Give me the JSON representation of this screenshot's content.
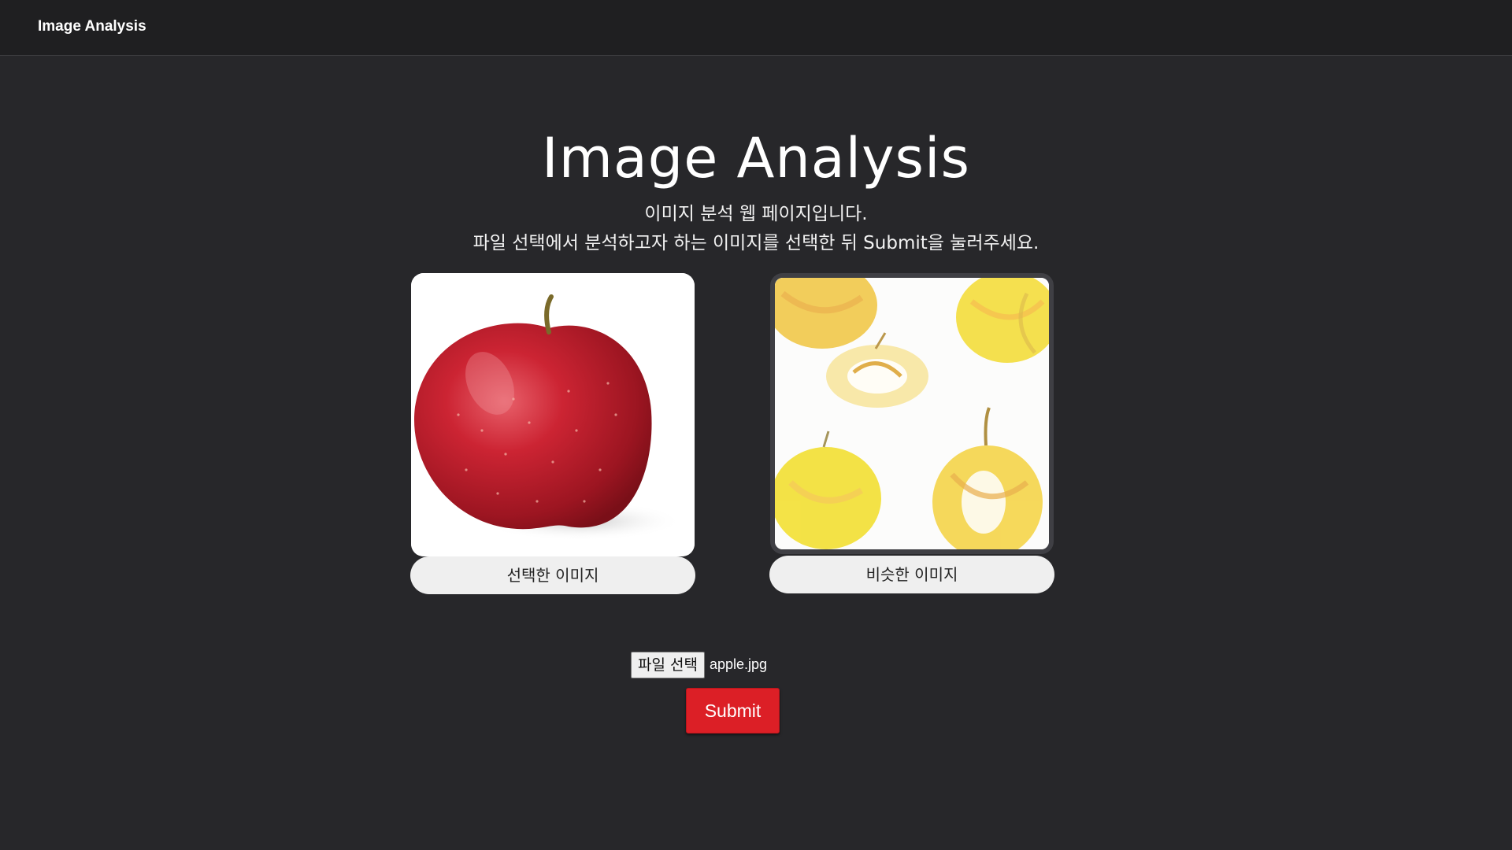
{
  "navbar": {
    "brand": "Image Analysis"
  },
  "hero": {
    "title": "Image Analysis",
    "subtitle_line1": "이미지 분석 웹 페이지입니다.",
    "subtitle_line2": "파일 선택에서 분석하고자 하는 이미지를 선택한 뒤 Submit을 눌러주세요."
  },
  "cards": {
    "selected": {
      "caption": "선택한 이미지",
      "image": "red-apple-photo"
    },
    "similar": {
      "caption": "비슷한 이미지",
      "image": "yellow-apples-painting"
    }
  },
  "upload": {
    "choose_label": "파일 선택",
    "file_name": "apple.jpg",
    "submit_label": "Submit"
  },
  "colors": {
    "background": "#27272a",
    "navbar": "#1f1f21",
    "submit": "#dc1f26",
    "caption_bg": "#efefef"
  }
}
